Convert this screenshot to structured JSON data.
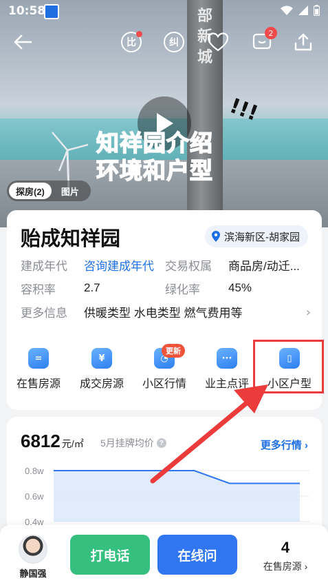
{
  "status_bar": {
    "time": "10:58",
    "app_icon": "house-app-icon",
    "signal_icons": [
      "wifi-icon",
      "cellular-signal-icon",
      "battery-icon"
    ]
  },
  "top_nav": {
    "back_icon": "back-arrow-icon",
    "compare_label": "比",
    "correct_label": "纠",
    "favorite_icon": "heart-icon",
    "message_icon": "message-icon",
    "message_badge": "2",
    "share_icon": "share-icon"
  },
  "hero": {
    "video_title_line1": "知祥园介绍",
    "video_title_line2": "环境和户型",
    "tower_text": "部新城",
    "play_icon": "play-icon",
    "exclaim": "!!!",
    "media_tabs": [
      {
        "label": "探房(2)",
        "active": true
      },
      {
        "label": "图片",
        "active": false
      }
    ]
  },
  "estate": {
    "name": "贻成知祥园",
    "location": "滨海新区-胡家园",
    "properties": [
      {
        "label": "建成年代",
        "value": "咨询建成年代",
        "link": true,
        "label2": "交易权属",
        "value2": "商品房/动迁..."
      },
      {
        "label": "容积率",
        "value": "2.7",
        "link": false,
        "label2": "绿化率",
        "value2": "45%"
      },
      {
        "label": "更多信息",
        "value": "供暖类型 水电类型 燃气费用等",
        "link": false,
        "label2": "",
        "value2": ""
      }
    ]
  },
  "features": [
    {
      "label": "在售房源",
      "icon": "listing-icon",
      "glyph": "="
    },
    {
      "label": "成交房源",
      "icon": "deal-icon",
      "glyph": "¥"
    },
    {
      "label": "小区行情",
      "icon": "market-trend-icon",
      "glyph": "◔",
      "tag": "更新"
    },
    {
      "label": "业主点评",
      "icon": "review-icon",
      "glyph": "···"
    },
    {
      "label": "小区户型",
      "icon": "floor-plan-icon",
      "glyph": "▯"
    }
  ],
  "price": {
    "value": "6812",
    "unit": "元/㎡",
    "desc": "5月挂牌均价",
    "more_label": "更多行情",
    "chevron": "›"
  },
  "chart_data": {
    "type": "area",
    "y_ticks": [
      "0.8w",
      "0.6w",
      "0.4w"
    ],
    "ylim": [
      0.4,
      0.8
    ],
    "series": [
      {
        "values": [
          0.8,
          0.8,
          0.8,
          0.8,
          0.8,
          0.7,
          0.7,
          0.7
        ]
      }
    ],
    "grid": true,
    "color": "#2f76f0"
  },
  "bottom_bar": {
    "agent_name": "静国强",
    "call_label": "打电话",
    "ask_label": "在线问",
    "onsale_count": "4",
    "onsale_label": "在售房源",
    "chevron": "›"
  },
  "colors": {
    "accent": "#2f76f0",
    "call_green": "#35c07f",
    "highlight_red": "#ec3b3b"
  }
}
